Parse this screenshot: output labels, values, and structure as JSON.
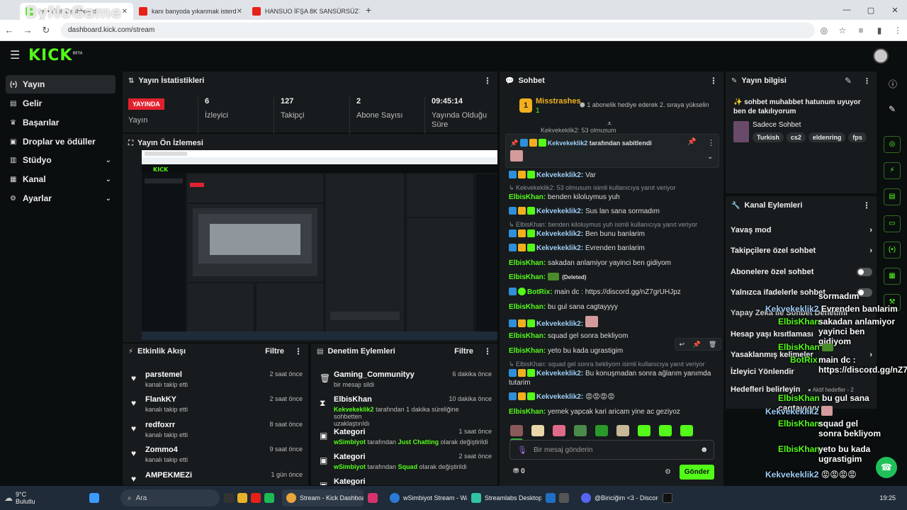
{
  "browser": {
    "tabs": [
      {
        "title": "tre • Kick Dashboard",
        "color": "#53fc18"
      },
      {
        "title": "kanı banyoda yıkanmak isterd",
        "color": "#e62117"
      },
      {
        "title": "HANSUO İFŞA 8K SANSÜRSÜZ",
        "color": "#e62117"
      }
    ],
    "url": "dashboard.kick.com/stream",
    "watermark": "ByNoGame"
  },
  "sidebar": {
    "items": [
      {
        "label": "Yayın",
        "icon": "(•)"
      },
      {
        "label": "Gelir",
        "icon": "▤"
      },
      {
        "label": "Başarılar",
        "icon": "🏆"
      },
      {
        "label": "Droplar ve ödüller",
        "icon": "🎁"
      },
      {
        "label": "Stüdyo",
        "icon": "▥"
      },
      {
        "label": "Kanal",
        "icon": "▦"
      },
      {
        "label": "Ayarlar",
        "icon": "⚙"
      }
    ]
  },
  "stats": {
    "title": "Yayın İstatistikleri",
    "live_label": "YAYINDA",
    "status_label": "Yayın",
    "items": [
      {
        "value": "6",
        "label": "İzleyici"
      },
      {
        "value": "127",
        "label": "Takipçi"
      },
      {
        "value": "2",
        "label": "Abone Sayısı"
      },
      {
        "value": "09:45:14",
        "label": "Yayında Olduğu Süre"
      }
    ]
  },
  "preview": {
    "title": "Yayın Ön İzlemesi"
  },
  "activity": {
    "title": "Etkinlik Akışı",
    "filter": "Filtre",
    "rows": [
      {
        "name": "parstemel",
        "sub": "kanalı takip etti",
        "time": "2 saat önce"
      },
      {
        "name": "FlankKY",
        "sub": "kanalı takip etti",
        "time": "2 saat önce"
      },
      {
        "name": "redfoxrr",
        "sub": "kanalı takip etti",
        "time": "8 saat önce"
      },
      {
        "name": "Zommo4",
        "sub": "kanalı takip etti",
        "time": "9 saat önce"
      },
      {
        "name": "AMPEKMEZi",
        "sub": "",
        "time": "1 gün önce"
      }
    ]
  },
  "moderation": {
    "title": "Denetim Eylemleri",
    "filter": "Filtre",
    "rows": [
      {
        "name": "Gaming_Communityy",
        "sub1": "",
        "sub2": "bir mesajı sildi",
        "sub3": "",
        "time": "6 dakika önce"
      },
      {
        "name": "ElbisKhan",
        "sub1": "Kekvekeklik2",
        "sub2": " tarafından 1 dakika süreliğine sohbetten",
        "sub3": "uzaklaştırıldı",
        "time": "10 dakika önce"
      },
      {
        "name": "Kategori",
        "sub1": "wSimbiyot",
        "sub2": " tarafından ",
        "sub2b": "Just Chatting",
        "sub3": " olarak değiştirildi",
        "time": "1 saat önce"
      },
      {
        "name": "Kategori",
        "sub1": "wSimbiyot",
        "sub2": " tarafından ",
        "sub2b": "Squad",
        "sub3": " olarak değiştirildi",
        "time": "2 saat önce"
      },
      {
        "name": "Kategori",
        "sub1": "",
        "sub2": "",
        "sub3": "",
        "time": ""
      }
    ]
  },
  "chat": {
    "title": "Sohbet",
    "top_user": "Misstrashes",
    "top_user_count": "1",
    "top_note": "1 abonelik hediye ederek 2. sıraya yükselin",
    "cut_line": "Kekvekeklik2: 53 olmusum",
    "pinned_by": "Kekvekeklik2",
    "pinned_text": "tarafından sabitlendi",
    "messages": [
      {
        "reply": "",
        "user": "Kekvekeklik2:",
        "text": " Var",
        "ucolor": "#9ecdf6"
      },
      {
        "reply": "Kekvekeklik2: 53 olmusum isimli kullanıcıya yanıt veriyor",
        "user": "ElbisKhan:",
        "text": " benden kiloluymus yuh",
        "ucolor": "#53fc18"
      },
      {
        "reply": "",
        "user": "Kekvekeklik2:",
        "text": " Sus lan sana sormadım",
        "ucolor": "#9ecdf6"
      },
      {
        "reply": "ElbisKhan: benden kiloluymus yuh isimli kullanıcıya yanıt veriyor",
        "user": "Kekvekeklik2:",
        "text": " Ben bunu banlarim",
        "ucolor": "#9ecdf6"
      },
      {
        "reply": "",
        "user": "Kekvekeklik2:",
        "text": " Evrenden banlarim",
        "ucolor": "#9ecdf6"
      },
      {
        "reply": "",
        "user": "ElbisKhan:",
        "text": " sakadan anlamiyor yayinci ben gidiyom",
        "ucolor": "#53fc18"
      },
      {
        "reply": "",
        "user": "ElbisKhan:",
        "text": " (Deleted)",
        "ucolor": "#53fc18"
      },
      {
        "reply": "",
        "user": "BotRix:",
        "text": " main dc : https://discord.gg/nZ7grUHJpz",
        "ucolor": "#53fc18"
      },
      {
        "reply": "",
        "user": "ElbisKhan:",
        "text": " bu gul sana cagtayyyy",
        "ucolor": "#53fc18"
      },
      {
        "reply": "",
        "user": "Kekvekeklik2:",
        "text": "",
        "ucolor": "#9ecdf6"
      },
      {
        "reply": "",
        "user": "ElbisKhan:",
        "text": " squad gel sonra bekliyom",
        "ucolor": "#53fc18"
      },
      {
        "reply": "",
        "user": "ElbisKhan:",
        "text": " yeto bu kada ugrastigim",
        "ucolor": "#53fc18"
      },
      {
        "reply": "ElbisKhan: squad gel sonra bekliyom isimli kullanıcıya yanıt veriyor",
        "user": "Kekvekeklik2:",
        "text": " Bu konuşmadan sonra ağlarım yanımda tutarim",
        "ucolor": "#9ecdf6"
      },
      {
        "reply": "",
        "user": "Kekvekeklik2:",
        "text": " 😡😡😡😡",
        "ucolor": "#9ecdf6"
      },
      {
        "reply": "",
        "user": "ElbisKhan:",
        "text": " yemek yapcak kari aricam yine ac geziyoz",
        "ucolor": "#53fc18"
      }
    ],
    "input_placeholder": "Bir mesaj gönderin",
    "points": "0",
    "send": "Gönder"
  },
  "streaminfo": {
    "title": "Yayın bilgisi",
    "stream_title": "✨ sohbet muhabbet hatunum uyuyor ben de takılıyorum",
    "category": "Sadece Sohbet",
    "tags": [
      "Turkish",
      "cs2",
      "eldenring",
      "fps"
    ]
  },
  "channel_actions": {
    "title": "Kanal Eylemleri",
    "items": [
      {
        "label": "Yavaş mod",
        "kind": "chevron"
      },
      {
        "label": "Takipçilere özel sohbet",
        "kind": "chevron"
      },
      {
        "label": "Abonelere özel sohbet",
        "kind": "toggle"
      },
      {
        "label": "Yalnızca ifadelerle sohbet",
        "kind": "toggle"
      },
      {
        "label": "Yapay Zeka ile Sohbet Denetimi",
        "kind": "none"
      },
      {
        "label": "Hesap yaşı kısıtlaması",
        "kind": "none"
      },
      {
        "label": "Yasaklanmış kelimeler",
        "kind": "chevron"
      },
      {
        "label": "İzleyici Yönlendir",
        "kind": "chevron"
      },
      {
        "label": "Hedefleri belirleyin",
        "kind": "none"
      }
    ],
    "active_goals": "Aktif hedefler - 2"
  },
  "overlay": [
    {
      "name": "",
      "text": "sormadım"
    },
    {
      "name": "Kekvekeklik2",
      "text": "Evrenden banlarim"
    },
    {
      "name": "ElbisKhan",
      "text": "sakadan anlamiyor yayinci ben gidiyom"
    },
    {
      "name": "ElbisKhan",
      "text": ""
    },
    {
      "name": "BotRix",
      "text": "main dc : https://discord.gg/nZ7grUHJpz"
    },
    {
      "name": "ElbisKhan",
      "text": "bu gul sana cagtayyyy"
    },
    {
      "name": "Kekvekeklik2",
      "text": ""
    },
    {
      "name": "ElbisKhan",
      "text": "squad gel sonra bekliyom"
    },
    {
      "name": "ElbisKhan",
      "text": "yeto bu kada ugrastigim"
    },
    {
      "name": "Kekvekeklik2",
      "text": "😡😡😡😡"
    },
    {
      "name": "ElbisKhan",
      "text": "yemek yapcak kari aricam yine ac geziyoz"
    }
  ],
  "taskbar": {
    "weather_temp": "9°C",
    "weather_desc": "Bulutlu",
    "search": "Ara",
    "apps": [
      {
        "label": "Stream - Kick Dashboar",
        "color": "#e9a53c"
      },
      {
        "label": "wSimbiyot Stream - Wa",
        "color": "#2b7bd6"
      },
      {
        "label": "Streamlabs Desktop",
        "color": "#31c3a2"
      },
      {
        "label": "@Biriciğim <3 - Discord",
        "color": "#5865f2"
      }
    ],
    "time": "19:25"
  },
  "colors": {
    "accent": "#53fc18",
    "live": "#e1222e",
    "panel": "#171b1d"
  }
}
